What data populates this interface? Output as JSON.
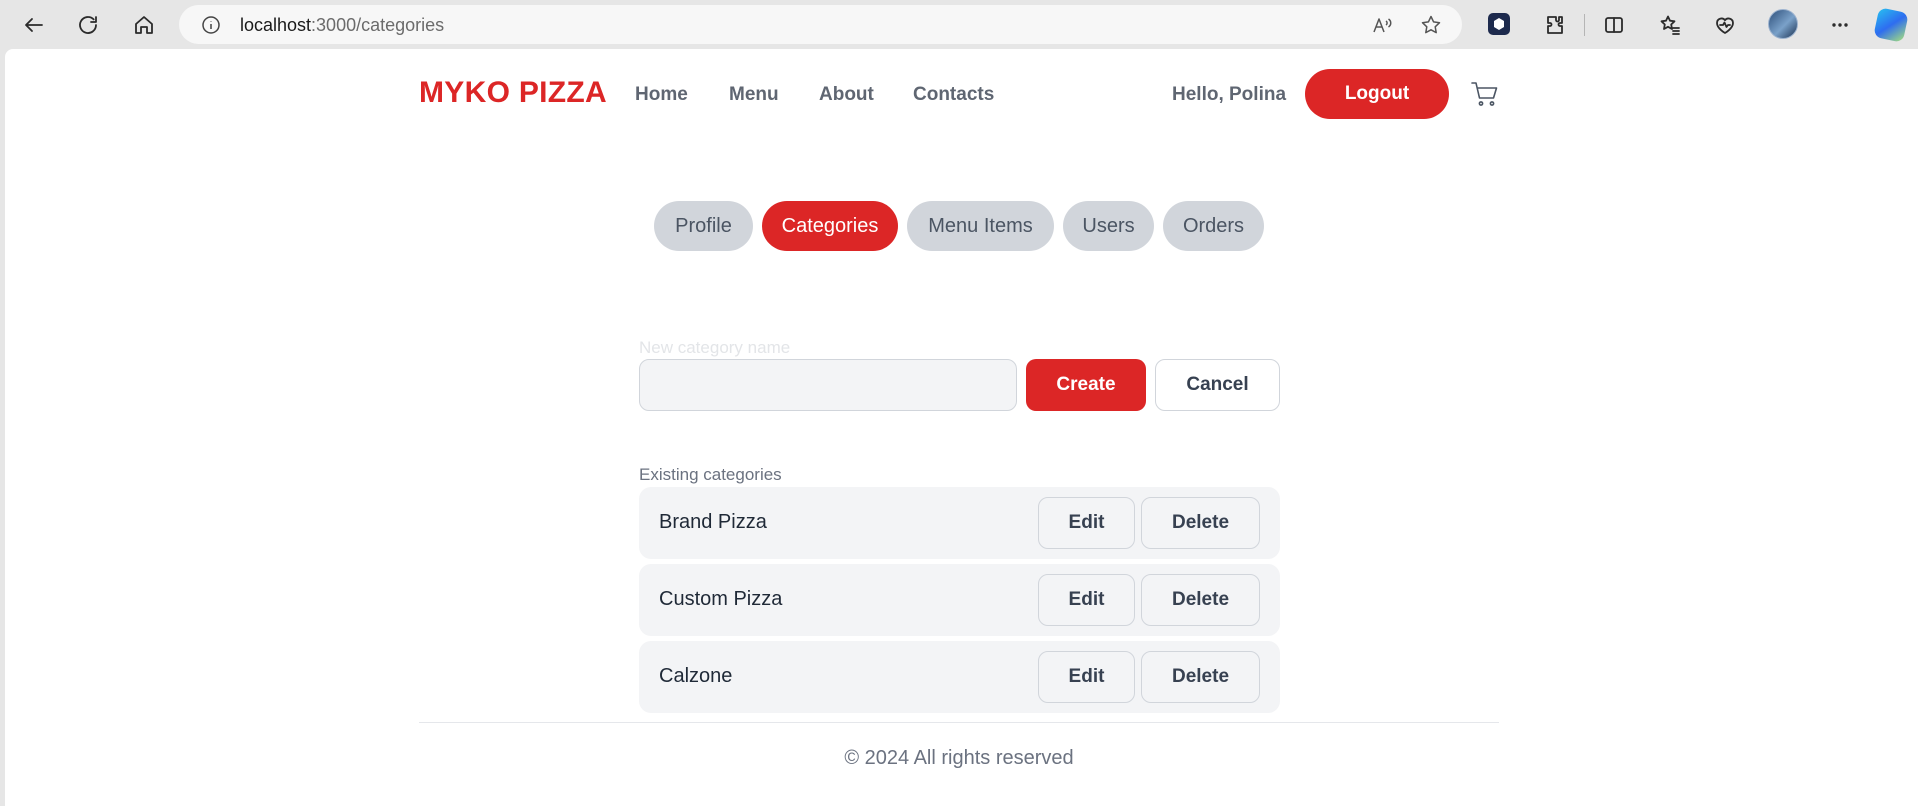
{
  "browser": {
    "url_host": "localhost",
    "url_path": ":3000/categories"
  },
  "header": {
    "logo": "MYKO PIZZA",
    "nav": [
      "Home",
      "Menu",
      "About",
      "Contacts"
    ],
    "greeting": "Hello, Polina",
    "logout_label": "Logout",
    "cart_icon": "cart-icon"
  },
  "tabs": [
    {
      "label": "Profile",
      "active": false
    },
    {
      "label": "Categories",
      "active": true
    },
    {
      "label": "Menu Items",
      "active": false
    },
    {
      "label": "Users",
      "active": false
    },
    {
      "label": "Orders",
      "active": false
    }
  ],
  "form": {
    "label": "New category name",
    "value": "",
    "create_label": "Create",
    "cancel_label": "Cancel"
  },
  "categories": {
    "heading": "Existing categories",
    "items": [
      {
        "name": "Brand Pizza"
      },
      {
        "name": "Custom Pizza"
      },
      {
        "name": "Calzone"
      }
    ],
    "edit_label": "Edit",
    "delete_label": "Delete"
  },
  "footer": {
    "text": "© 2024 All rights reserved"
  },
  "colors": {
    "accent": "#dc2626",
    "tab_inactive": "#d1d5db",
    "row_bg": "#f3f4f6"
  }
}
